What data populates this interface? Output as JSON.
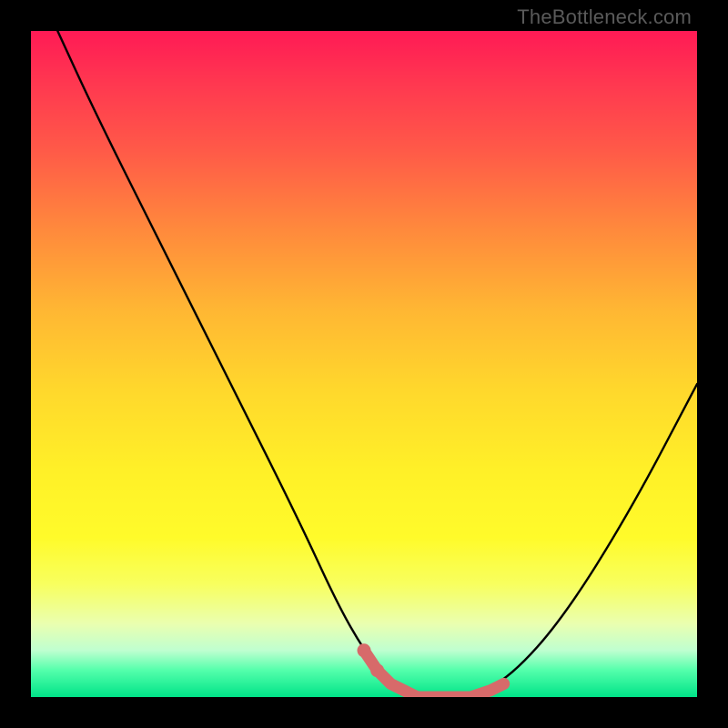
{
  "attribution": "TheBottleneck.com",
  "colors": {
    "page_bg": "#000000",
    "curve_stroke": "#000000",
    "marker_fill": "#d76a6a"
  },
  "chart_data": {
    "type": "line",
    "title": "",
    "xlabel": "",
    "ylabel": "",
    "xlim": [
      0,
      100
    ],
    "ylim": [
      0,
      100
    ],
    "x": [
      4,
      10,
      20,
      30,
      40,
      46,
      50,
      54,
      58,
      62,
      66,
      72,
      80,
      90,
      100
    ],
    "values": [
      100,
      87,
      67,
      47,
      27,
      14,
      7,
      2,
      0,
      0,
      0,
      3,
      12,
      28,
      47
    ],
    "annotations": {
      "description": "V-shaped bottleneck curve descending steeply from top-left, flat near zero around x≈56–66, then rising toward right",
      "markers": [
        {
          "x": 50,
          "y": 7
        },
        {
          "x": 52,
          "y": 4
        },
        {
          "x": 54,
          "y": 2
        },
        {
          "x": 58,
          "y": 0
        },
        {
          "x": 62,
          "y": 0
        },
        {
          "x": 66,
          "y": 0
        },
        {
          "x": 69,
          "y": 1
        },
        {
          "x": 71,
          "y": 2
        }
      ]
    }
  }
}
